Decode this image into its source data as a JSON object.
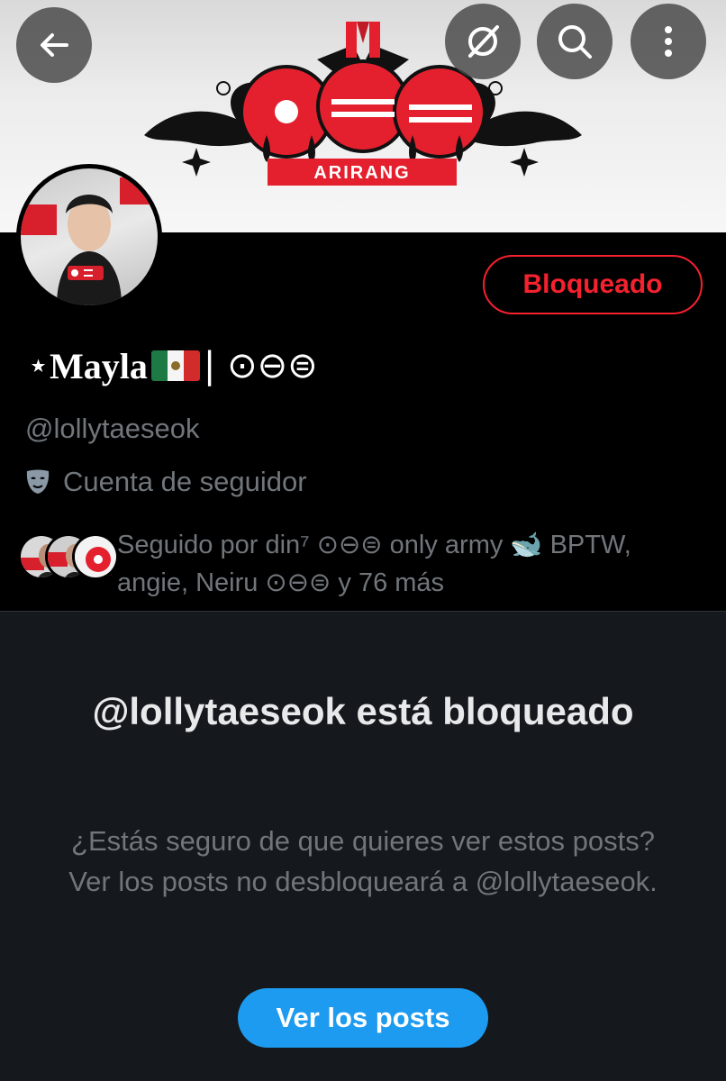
{
  "banner": {
    "logo_text": "ARIRANG",
    "colors": {
      "red": "#e5202e",
      "black": "#111111"
    }
  },
  "top_bar": {
    "back_icon": "arrow-left-icon",
    "grok_icon": "grok-slash-icon",
    "search_icon": "search-icon",
    "more_icon": "more-vertical-icon"
  },
  "profile": {
    "block_button": "Bloqueado",
    "name_prefix": "⋆",
    "name": "Mayla",
    "flag_icon": "mexico-flag-icon",
    "name_suffix": "| ⊙⊖⊜",
    "handle": "@lollytaeseok",
    "account_type": "Cuenta de seguidor",
    "account_type_icon": "mask-icon",
    "followed_by": "Seguido por din⁷ ⊙⊖⊜ only army 🐋 BPTW, angie, Neiru ⊙⊖⊜ y 76 más"
  },
  "blocked_panel": {
    "title": "@lollytaeseok está bloqueado",
    "description": "¿Estás seguro de que quieres ver estos posts? Ver los posts no desbloqueará a @lollytaeseok.",
    "button": "Ver los posts"
  },
  "colors": {
    "danger": "#f4212e",
    "primary": "#1d9bf0",
    "muted": "#71767b",
    "panel_bg": "#15181c"
  }
}
